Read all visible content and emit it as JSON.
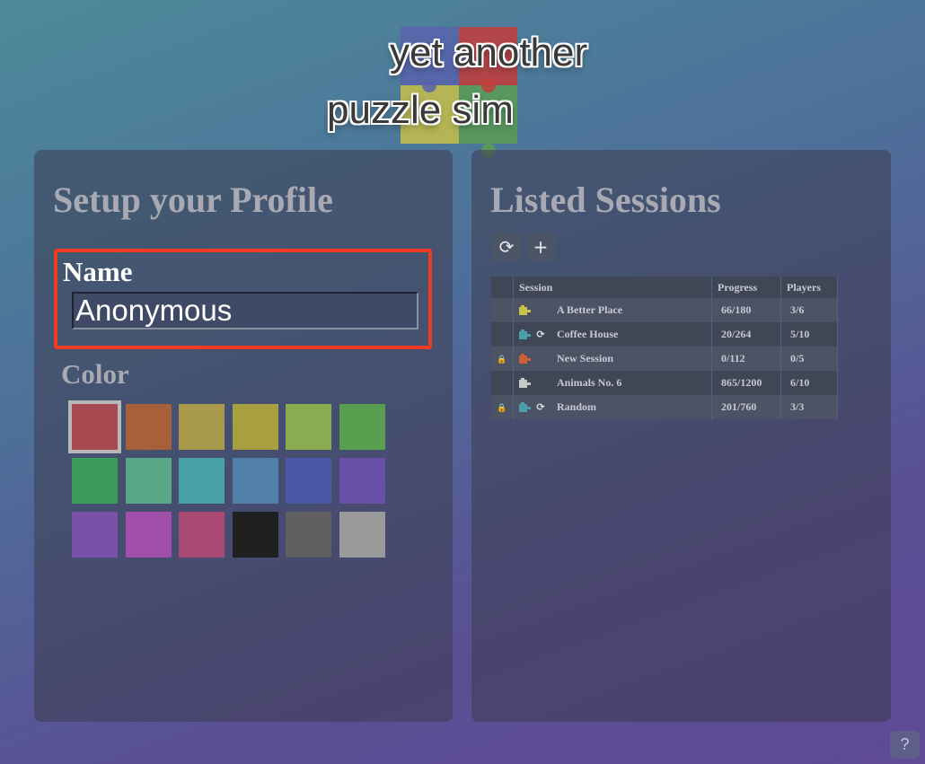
{
  "logo": {
    "line1": "yet another",
    "line2": "puzzle sim",
    "piece_colors": [
      "#5863ad",
      "#c43c3a",
      "#c8c04a",
      "#5c9c54"
    ]
  },
  "profile": {
    "title": "Setup your Profile",
    "name_label": "Name",
    "name_value": "Anonymous",
    "color_label": "Color",
    "colors": [
      "#a84a52",
      "#a8603a",
      "#a89a4a",
      "#a8a040",
      "#8aac50",
      "#58a050",
      "#3a9c58",
      "#58a888",
      "#4aa0a8",
      "#5080a8",
      "#4a58a8",
      "#6a50a8",
      "#7a50a8",
      "#a050a8",
      "#a84a72",
      "#202020",
      "#606060",
      "#9a9a9a"
    ],
    "selected_color_index": 0
  },
  "sessions": {
    "title": "Listed Sessions",
    "refresh_icon": "refresh-icon",
    "add_icon": "plus-icon",
    "columns": [
      "Session",
      "Progress",
      "Players"
    ],
    "rows": [
      {
        "locked": false,
        "color": "#c8c04a",
        "cycle": false,
        "name": "A Better Place",
        "progress": "66/180",
        "players": "3/6"
      },
      {
        "locked": false,
        "color": "#4aa0a8",
        "cycle": true,
        "name": "Coffee House",
        "progress": "20/264",
        "players": "5/10"
      },
      {
        "locked": true,
        "color": "#c8603a",
        "cycle": false,
        "name": "New Session",
        "progress": "0/112",
        "players": "0/5"
      },
      {
        "locked": false,
        "color": "#c8c8c8",
        "cycle": false,
        "name": "Animals No. 6",
        "progress": "865/1200",
        "players": "6/10"
      },
      {
        "locked": true,
        "color": "#4aa0a8",
        "cycle": true,
        "name": "Random",
        "progress": "201/760",
        "players": "3/3"
      }
    ]
  },
  "help_label": "?"
}
